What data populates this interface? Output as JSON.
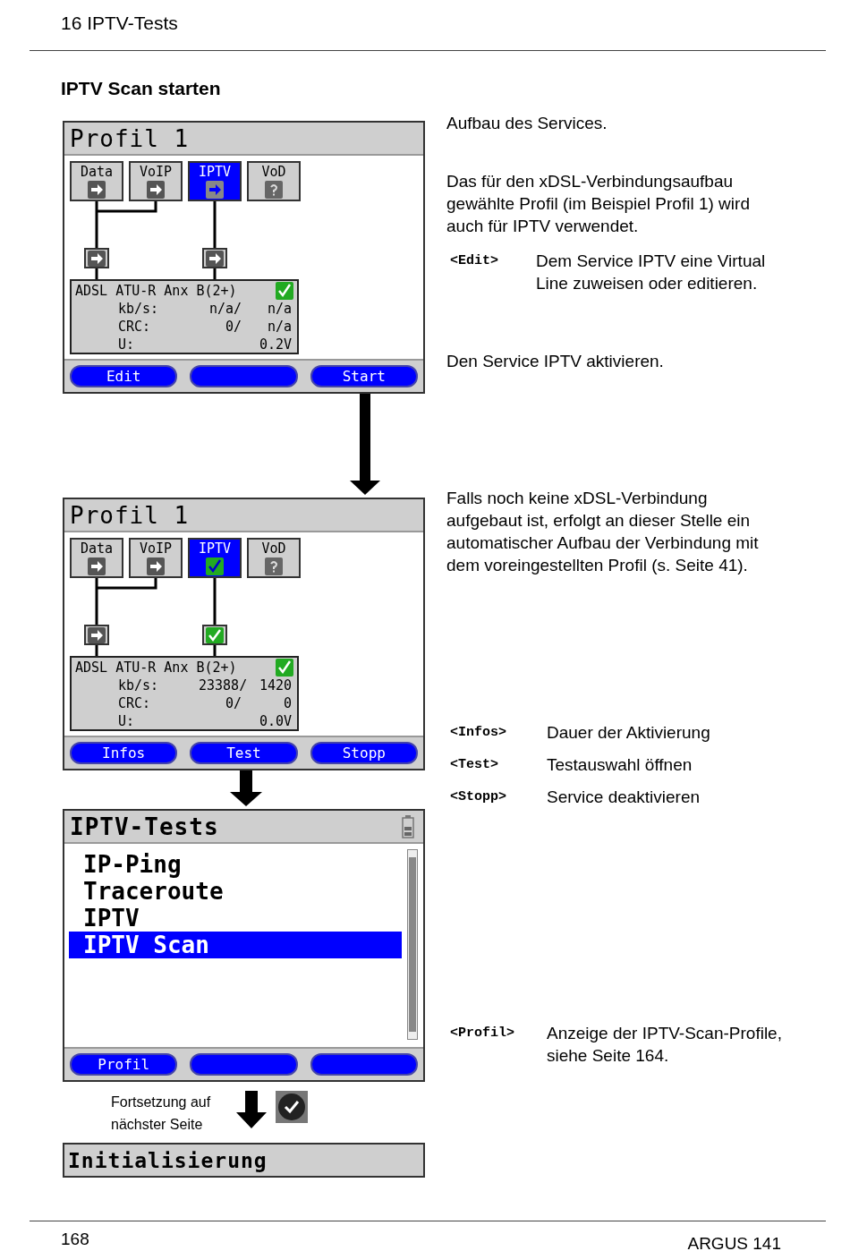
{
  "header": {
    "chapter": "16 IPTV-Tests"
  },
  "heading": "IPTV Scan starten",
  "steps": [
    {
      "screen": {
        "kind": "profile",
        "title": "Profil 1",
        "services": [
          {
            "label": "Data",
            "kind": "arrow",
            "selected": false
          },
          {
            "label": "VoIP",
            "kind": "arrow",
            "selected": false
          },
          {
            "label": "IPTV",
            "kind": "arrow",
            "selected": true
          },
          {
            "label": "VoD",
            "kind": "unknown",
            "selected": false
          }
        ],
        "nodes": [
          {
            "kind": "arrow"
          },
          {
            "kind": "arrow"
          }
        ],
        "line": {
          "title": "ADSL ATU-R Anx B(2+)",
          "connected": true,
          "rows": [
            {
              "label": "kb/s:",
              "value_1": "n/a/",
              "value_2": "n/a"
            },
            {
              "label": "CRC:",
              "value_1": "0/",
              "value_2": "n/a"
            },
            {
              "label": "U:",
              "value_2": "0.2V"
            }
          ]
        },
        "softkeys": [
          {
            "kind": "labeled",
            "label": "Edit"
          },
          {
            "kind": "blank"
          },
          {
            "kind": "labeled",
            "label": "Start"
          }
        ]
      },
      "notes": [
        {
          "kind": "para",
          "text": "Aufbau des Services."
        },
        {
          "kind": "para",
          "text": "Das für den xDSL-Verbindungsaufbau gewählte Profil (im Beispiel Profil 1) wird auch für IPTV verwendet."
        },
        {
          "kind": "key",
          "key": "<Edit>",
          "text": "Dem Service IPTV eine Virtual Line zuweisen oder editieren."
        },
        {
          "kind": "para",
          "text": "Den Service IPTV aktivieren."
        }
      ]
    },
    {
      "screen": {
        "kind": "profile",
        "title": "Profil 1",
        "services": [
          {
            "label": "Data",
            "kind": "arrow",
            "selected": false
          },
          {
            "label": "VoIP",
            "kind": "arrow",
            "selected": false
          },
          {
            "label": "IPTV",
            "kind": "check",
            "selected": true
          },
          {
            "label": "VoD",
            "kind": "unknown",
            "selected": false
          }
        ],
        "nodes": [
          {
            "kind": "arrow"
          },
          {
            "kind": "check"
          }
        ],
        "line": {
          "title": "ADSL ATU-R Anx B(2+)",
          "connected": true,
          "rows": [
            {
              "label": "kb/s:",
              "value_1": "23388/",
              "value_2": "1420"
            },
            {
              "label": "CRC:",
              "value_1": "0/",
              "value_2": "0"
            },
            {
              "label": "U:",
              "value_2": "0.0V"
            }
          ]
        },
        "softkeys": [
          {
            "kind": "labeled",
            "label": "Infos"
          },
          {
            "kind": "labeled",
            "label": "Test"
          },
          {
            "kind": "labeled",
            "label": "Stopp"
          }
        ]
      },
      "notes": [
        {
          "kind": "para",
          "text": "Falls noch keine xDSL-Verbindung aufgebaut ist, erfolgt an dieser Stelle ein automatischer Aufbau der Verbindung mit dem voreingestellten Profil (s. Seite 41)."
        },
        {
          "kind": "key",
          "key": "<Infos>",
          "text": "Dauer der Aktivierung"
        },
        {
          "kind": "key",
          "key": "<Test>",
          "text": "Testauswahl öffnen"
        },
        {
          "kind": "key",
          "key": "<Stopp>",
          "text": "Service deaktivieren"
        }
      ]
    },
    {
      "screen": {
        "kind": "menu",
        "title": "IPTV-Tests",
        "items": [
          {
            "label": "IP-Ping",
            "selected": false
          },
          {
            "label": "Traceroute",
            "selected": false
          },
          {
            "label": "IPTV",
            "selected": false
          },
          {
            "label": "IPTV Scan",
            "selected": true
          }
        ],
        "softkeys": [
          {
            "kind": "labeled",
            "label": "Profil"
          },
          {
            "kind": "blank"
          },
          {
            "kind": "blank"
          }
        ]
      },
      "continuation": {
        "text": "Fortsetzung auf nächster Seite"
      },
      "notes": [
        {
          "kind": "key",
          "key": "<Profil>",
          "text": "Anzeige der IPTV-Scan-Profile, siehe Seite 164."
        }
      ]
    },
    {
      "screen": {
        "kind": "status",
        "title": "Initialisierung"
      }
    }
  ],
  "footer": {
    "page": "168",
    "product": "ARGUS 141"
  }
}
